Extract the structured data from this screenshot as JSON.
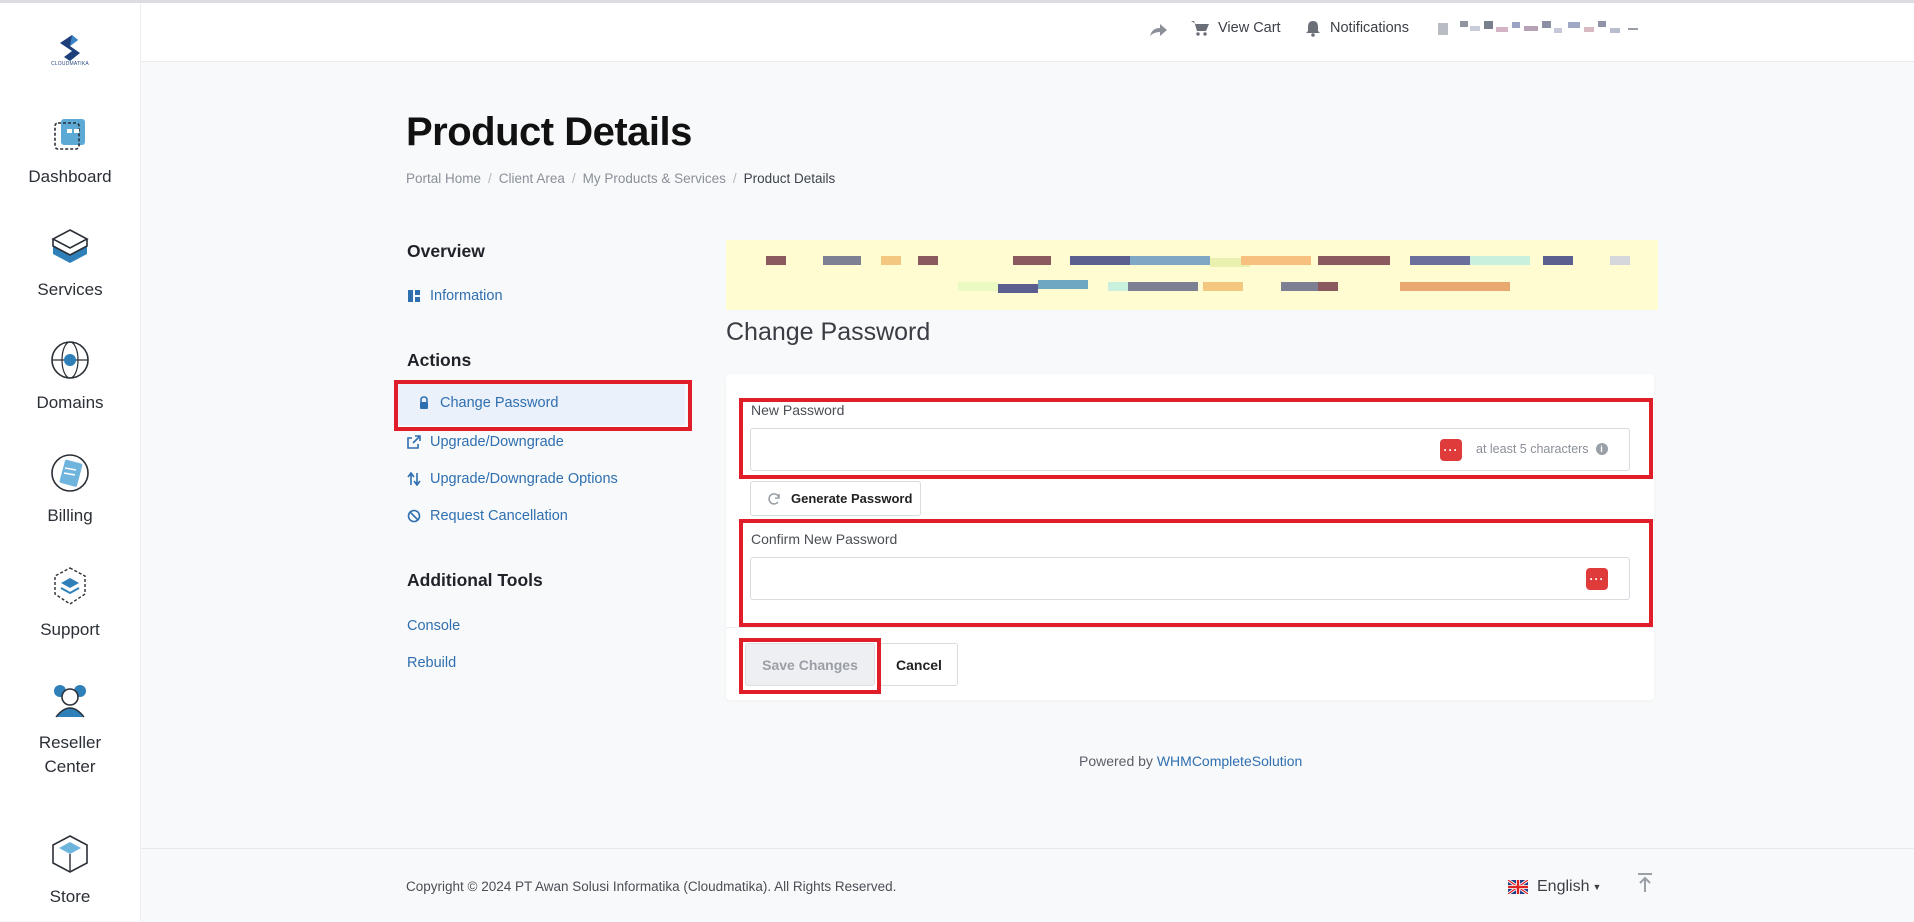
{
  "sidebar": {
    "logo_text": "CLOUDMATIKA",
    "items": [
      {
        "label": "Dashboard",
        "icon": "dashboard-icon"
      },
      {
        "label": "Services",
        "icon": "services-icon"
      },
      {
        "label": "Domains",
        "icon": "domains-icon"
      },
      {
        "label": "Billing",
        "icon": "billing-icon"
      },
      {
        "label": "Support",
        "icon": "support-icon"
      },
      {
        "label": "Reseller",
        "label2": "Center",
        "icon": "reseller-center-icon"
      },
      {
        "label": "Store",
        "icon": "store-icon"
      }
    ]
  },
  "header": {
    "share_icon": "share-icon",
    "view_cart": "View Cart",
    "notifications": "Notifications"
  },
  "page": {
    "title": "Product Details",
    "breadcrumb": [
      "Portal Home",
      "Client Area",
      "My Products & Services",
      "Product Details"
    ]
  },
  "side": {
    "overview_heading": "Overview",
    "information": "Information",
    "actions_heading": "Actions",
    "change_password": "Change Password",
    "upgrade_downgrade": "Upgrade/Downgrade",
    "upgrade_downgrade_options": "Upgrade/Downgrade Options",
    "request_cancellation": "Request Cancellation",
    "additional_tools_heading": "Additional Tools",
    "console": "Console",
    "rebuild": "Rebuild"
  },
  "form": {
    "section_title": "Change Password",
    "new_password_label": "New Password",
    "new_password_value": "",
    "new_password_hint": "at least 5 characters",
    "generate_password": "Generate Password",
    "confirm_password_label": "Confirm New Password",
    "confirm_password_value": "",
    "save_changes": "Save Changes",
    "cancel": "Cancel"
  },
  "powered": {
    "prefix": "Powered by",
    "link": "WHMCompleteSolution"
  },
  "footer": {
    "copyright": "Copyright © 2024 PT Awan Solusi Informatika (Cloudmatika). All Rights Reserved.",
    "language": "English"
  },
  "colors": {
    "accent": "#2f6fb0",
    "highlight_red": "#e01e2a",
    "notice_bg": "#fffcd1",
    "password_button": "#e03b3b"
  }
}
